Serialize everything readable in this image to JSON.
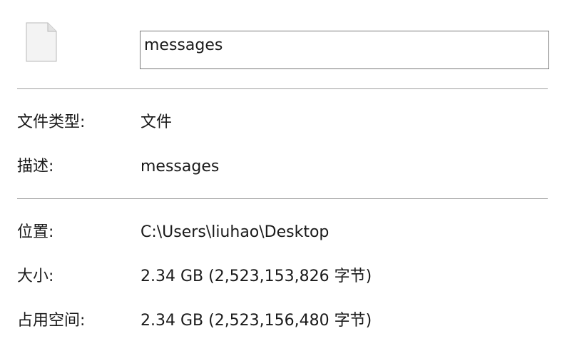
{
  "header": {
    "icon": "generic-file-icon",
    "filename_value": "messages"
  },
  "general": {
    "file_type_label": "文件类型:",
    "file_type_value": "文件",
    "description_label": "描述:",
    "description_value": "messages"
  },
  "details": {
    "location_label": "位置:",
    "location_value": "C:\\Users\\liuhao\\Desktop",
    "size_label": "大小:",
    "size_value": "2.34 GB (2,523,153,826 字节)",
    "size_on_disk_label": "占用空间:",
    "size_on_disk_value": "2.34 GB (2,523,156,480 字节)"
  },
  "colors": {
    "divider": "#a0a0a0",
    "input_border": "#7a7a7a",
    "text": "#1a1a1a"
  }
}
